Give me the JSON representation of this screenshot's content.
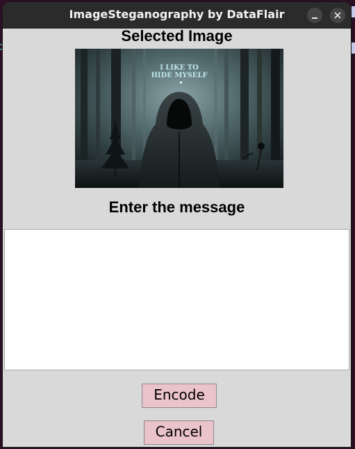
{
  "window": {
    "title": "ImageSteganography by DataFlair",
    "controls": [
      "minimize-icon",
      "close-icon"
    ]
  },
  "selected_image": {
    "heading": "Selected Image",
    "caption_line1": "I LIKE TO",
    "caption_line2": "HIDE MYSELF"
  },
  "message": {
    "heading": "Enter the message",
    "value": ""
  },
  "buttons": {
    "encode_label": "Encode",
    "cancel_label": "Cancel"
  },
  "colors": {
    "titlebar": "#2b2b2b",
    "window_bg": "#d9d9d9",
    "button_bg": "#ebc3cb",
    "desktop_bg": "#2c0f24"
  }
}
